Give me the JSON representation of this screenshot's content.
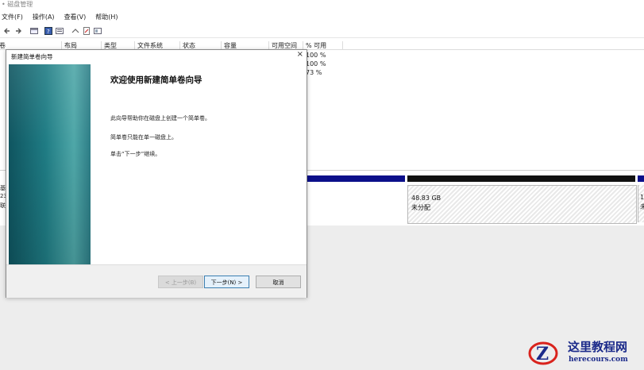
{
  "window": {
    "title": "磁盘管理"
  },
  "menu": [
    "文件(F)",
    "操作(A)",
    "查看(V)",
    "帮助(H)"
  ],
  "columns": [
    "卷",
    "布局",
    "类型",
    "文件系统",
    "状态",
    "容量",
    "可用空间",
    "% 可用"
  ],
  "volume_rows": [
    {
      "free_pct": "100 %"
    },
    {
      "free_pct": "100 %"
    },
    {
      "free_pct": "73 %"
    }
  ],
  "disk_pane": {
    "left_labels": [
      "基",
      "23",
      "联"
    ],
    "unallocated": {
      "size": "48.83 GB",
      "status": "未分配"
    },
    "edge_labels": [
      "1",
      "未"
    ]
  },
  "wizard": {
    "title": "新建简单卷向导",
    "close_glyph": "×",
    "heading": "欢迎使用新建简单卷向导",
    "paragraphs": [
      "此向导帮助你在磁盘上创建一个简单卷。",
      "简单卷只能在单一磁盘上。",
      "单击“下一步”继续。"
    ],
    "buttons": {
      "back": "< 上一步(B)",
      "next": "下一步(N) >",
      "cancel": "取消"
    }
  },
  "watermark": {
    "site_name": "这里教程网",
    "url": "herecours.com",
    "logo_letter": "Z"
  },
  "colors": {
    "navy_bar": "#0b0f8a",
    "accent": "#1b2a8a",
    "sidebar_teal": "#1f7c84",
    "watermark_red": "#d9231d"
  }
}
